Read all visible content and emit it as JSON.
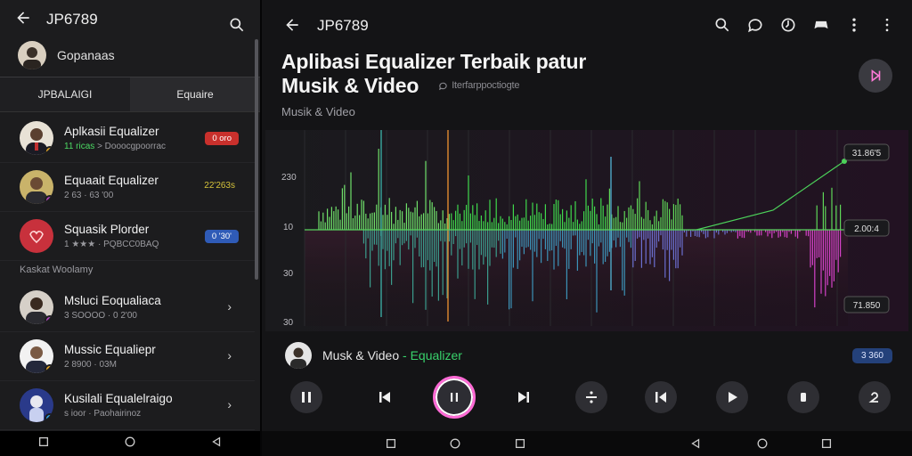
{
  "left": {
    "title": "JP6789",
    "profile_name": "Gopanaas",
    "tabs": [
      "JPBALAIGI",
      "Equaire"
    ],
    "items": [
      {
        "title": "Aplkasii Equalizer",
        "sub_accent": "11 ricas",
        "sub": "> Dooocgpoorrac",
        "badge": "0 oro",
        "badge_color": "#c9302c"
      },
      {
        "title": "Equaait Equalizer",
        "sub_accent": "",
        "sub": "2 63 · 63 '00",
        "amount": "22'263s"
      },
      {
        "title": "Squasik Plorder",
        "sub_accent": "",
        "sub": "1 ★★★ · PQBCC0BAQ",
        "badge": "0 '30'",
        "badge_color": "#2f5bb7"
      }
    ],
    "section_label": "Kaskat Woolamy",
    "items2": [
      {
        "title": "Msluci Eoqualiaca",
        "sub": "3 SOOOO · 0 2'00",
        "chev": "›"
      },
      {
        "title": "Mussic Equaliepr",
        "sub": "2 8900 · 03M",
        "chev": "›"
      },
      {
        "title": "Kusilali Equalelraigo",
        "sub": "s ioor · Paohairinoz",
        "chev": "›"
      }
    ]
  },
  "right": {
    "title": "JP6789",
    "headline_line1": "Aplibasi Equalizer Terbaik patur",
    "headline_line2": "Musik & Video",
    "tagline": "Iterfarppoctiogte",
    "subtitle": "Musik & Video",
    "y_axis": [
      "230",
      "10",
      "30",
      "30"
    ],
    "value_boxes": [
      "31.86'5",
      "2.00:4",
      "71.850"
    ],
    "now_playing": {
      "text": "Musk & Video",
      "accent": " - Equalizer",
      "badge": "3 360"
    }
  },
  "colors": {
    "green": "#39d353",
    "magenta": "#d43fd0",
    "accent_pink": "#ff6ad5",
    "badge_blue": "#24417a"
  }
}
